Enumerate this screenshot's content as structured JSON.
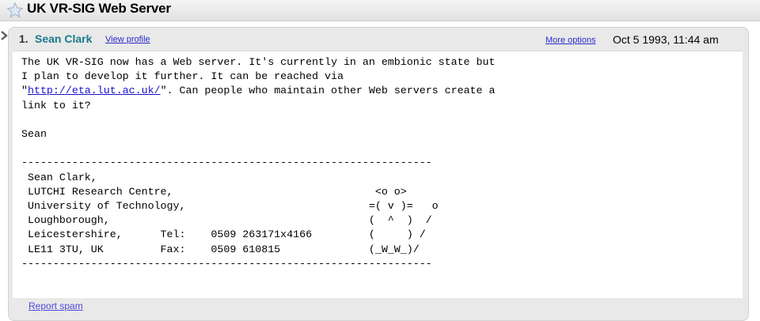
{
  "thread": {
    "title": "UK VR-SIG Web Server"
  },
  "message": {
    "index": "1.",
    "author": "Sean Clark",
    "view_profile": "View profile",
    "more_options": "More options",
    "date": "Oct 5 1993, 11:44 am",
    "body_before_link": "The UK VR-SIG now has a Web server. It's currently in an embionic state but\nI plan to develop it further. It can be reached via\n\"",
    "link": "http://eta.lut.ac.uk/",
    "body_after_link": "\". Can people who maintain other Web servers create a\nlink to it?\n\nSean\n\n-----------------------------------------------------------------\n Sean Clark,\n LUTCHI Research Centre,                                <o o>\n University of Technology,                             =( v )=   o\n Loughborough,                                         (  ^  )  /\n Leicestershire,      Tel:    0509 263171x4166         (     ) /\n LE11 3TU, UK         Fax:    0509 610815              (_W_W_)/\n-----------------------------------------------------------------",
    "report_spam": "Report spam"
  },
  "icons": {
    "star": "star-icon",
    "arrow": "expand-arrow-icon"
  }
}
